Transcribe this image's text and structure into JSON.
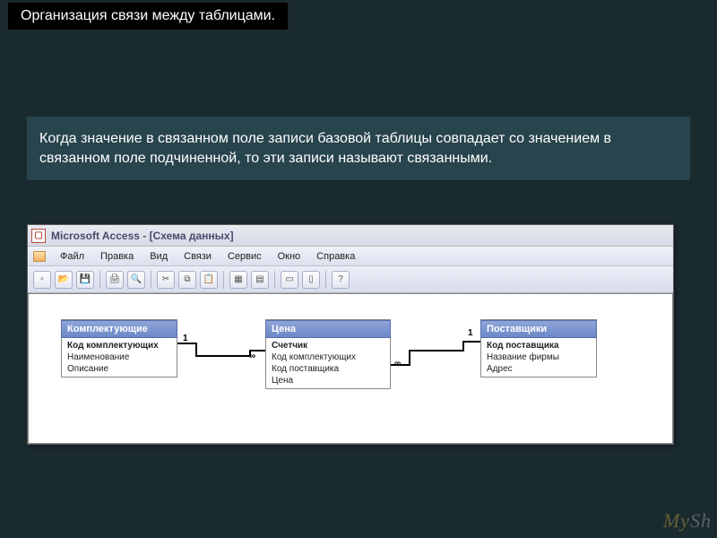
{
  "slide": {
    "title": "Организация связи между таблицами.",
    "description": "Когда значение в связанном поле записи базовой таблицы совпадает со значением в связанном поле подчиненной, то эти записи называют связанными."
  },
  "app": {
    "title": "Microsoft Access - [Схема данных]",
    "menu": [
      "Файл",
      "Правка",
      "Вид",
      "Связи",
      "Сервис",
      "Окно",
      "Справка"
    ]
  },
  "tables": {
    "t1": {
      "name": "Комплектующие",
      "rows": [
        "Код комплектующих",
        "Наименование",
        "Описание"
      ]
    },
    "t2": {
      "name": "Цена",
      "rows": [
        "Счетчик",
        "Код комплектующих",
        "Код поставщика",
        "Цена"
      ]
    },
    "t3": {
      "name": "Поставщики",
      "rows": [
        "Код поставщика",
        "Название фирмы",
        "Адрес"
      ]
    }
  },
  "rel": {
    "one": "1",
    "many": "∞"
  },
  "watermark": {
    "a": "My",
    "b": "Sh"
  }
}
